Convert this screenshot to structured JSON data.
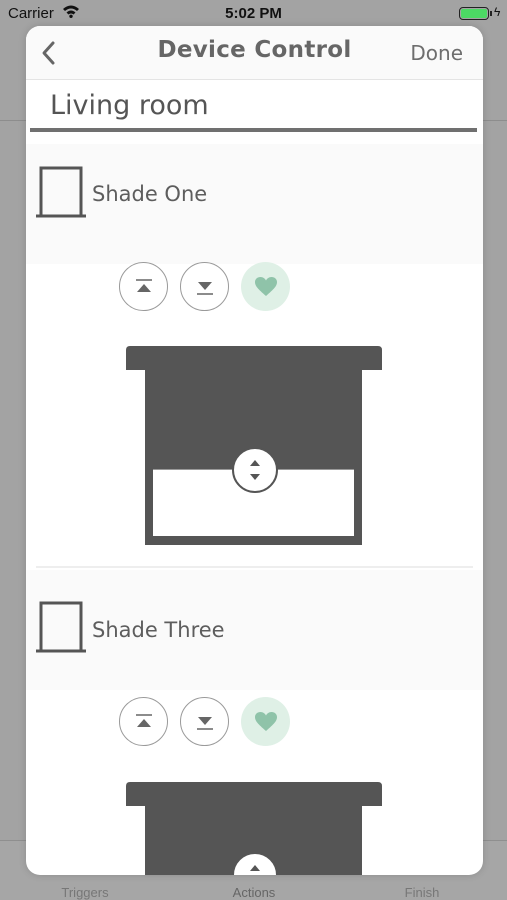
{
  "status_bar": {
    "carrier": "Carrier",
    "time": "5:02 PM"
  },
  "background_tabs": [
    {
      "label": "Triggers",
      "active": false
    },
    {
      "label": "Actions",
      "active": true
    },
    {
      "label": "Finish",
      "active": false
    }
  ],
  "nav": {
    "title": "Device Control",
    "done_label": "Done",
    "back_icon": "chevron-left-icon"
  },
  "room_name": "Living room",
  "devices": [
    {
      "name": "Shade One",
      "position_percent": 60,
      "favorite": true
    },
    {
      "name": "Shade Three",
      "favorite": true
    }
  ],
  "colors": {
    "shade_fabric": "#555555",
    "favorite_bg": "#dff0e6",
    "favorite_heart": "#8fc3a9",
    "battery": "#4cd964"
  }
}
